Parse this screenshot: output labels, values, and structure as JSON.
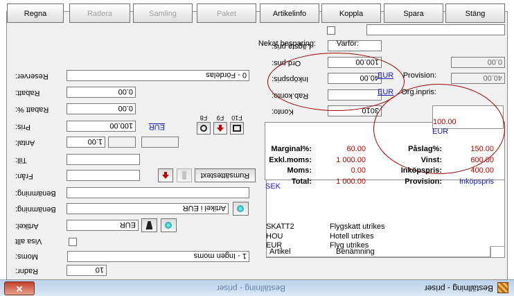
{
  "window": {
    "title": "Beställning - priser",
    "screenshot_title": "Beställning - priser",
    "close_glyph": "✕"
  },
  "left": {
    "radnr_label": "Radnr:",
    "radnr_value": "10",
    "moms_label": "Moms:",
    "moms_value": "1 - Ingen moms",
    "visa_alt_label": "Visa allt",
    "artikel_label": "Artikel:",
    "artikel_value": "EUR",
    "benamning1_label": "Benämning:",
    "benamning1_value": "Artikel i EUR",
    "benamning2_label": "Benämning:",
    "benamning2_value": "",
    "fran_label": "Från:",
    "fran_value": "",
    "till_label": "Till:",
    "till_value": "",
    "antal_label": "Antal:",
    "antal_value": "1.00",
    "pris_label": "Pris:",
    "pris_value": "100.00",
    "pris_currency": "EUR",
    "rabatt_pct_label": "Rabatt %:",
    "rabatt_pct_value": "0.00",
    "rabatt_label": "Rabatt:",
    "rabatt_value": "0.00",
    "reserver_label": "Reserver:",
    "reserver_value": "0 - Fördelas",
    "rumsattesext_label": "Rumsättestext",
    "f8": "F8",
    "f9": "F9",
    "f10": "F10"
  },
  "right": {
    "grid": {
      "headers": [
        "Artikel",
        "Benämning"
      ],
      "rows": [
        {
          "artikel": "EUR",
          "benamning": "Flyg utrikes"
        },
        {
          "artikel": "HOU",
          "benamning": "Hotell utrikes"
        },
        {
          "artikel": "SKATT2",
          "benamning": "Flygskatt utrikes"
        }
      ]
    },
    "summary": {
      "currency_tag": "SEK",
      "rows": [
        {
          "l1": "Total:",
          "v1": "1 000.00",
          "l2": "Provision:",
          "v2": "Inköpspris"
        },
        {
          "l1": "Moms:",
          "v1": "0.00",
          "l2": "Inköpspris:",
          "v2": "400.00"
        },
        {
          "l1": "Exkl.moms:",
          "v1": "1 000.00",
          "l2": "Vinst:",
          "v2": "600.00"
        },
        {
          "l1": "Marginal%:",
          "v1": "60.00",
          "l2": "Påslag%:",
          "v2": "150.00"
        }
      ],
      "box_value": "100.00",
      "box_currency": "EUR"
    },
    "konto_label": "Konto:",
    "konto_value": "3010",
    "rabkonto_label": "Rab.konto:",
    "rabkonto_value": "",
    "inkopspris_label": "Inköpspris:",
    "inkopspris_value": "40.00",
    "inkopspris_currency": "EUR",
    "orginkpris_label": "Org.inpris:",
    "orginkpris_value": "40.00",
    "ordpris_label": "Ord.pris:",
    "ordpris_value": "100.00",
    "ordpris_currency": "EUR",
    "provision_label": "Provision:",
    "provision_value": "0.00",
    "lagsta_label": "Lägsta pris:",
    "lagsta_value": "",
    "nekat_label": "Nekat besparing:",
    "varfor_label": "Varför:",
    "varfor_value": ""
  },
  "tabs": [
    "Regna",
    "Radera",
    "Samling",
    "Paket",
    "Artikelinfo",
    "Koppla",
    "Spara",
    "Stäng"
  ]
}
